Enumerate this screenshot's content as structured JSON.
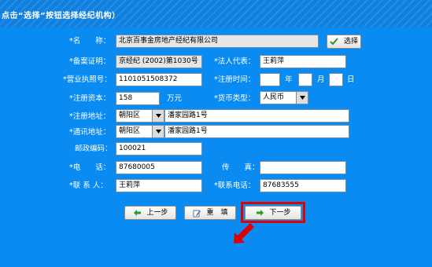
{
  "header": {
    "instruction": "点击“选择”按钮选择经纪机构）"
  },
  "form": {
    "name": {
      "label": "名　　称：",
      "value": "北京百事金房地产经纪有限公司",
      "select_button": "选择"
    },
    "filing_cert": {
      "label": "备案证明：",
      "value": "京经纪 (2002)第1030号"
    },
    "legal_rep": {
      "label": "法人代表：",
      "value": "王莉萍"
    },
    "business_license": {
      "label": "营业执照号：",
      "value": "1101051508372"
    },
    "reg_time": {
      "label": "注册时间：",
      "year_unit": "年",
      "month_unit": "月",
      "day_unit": "日",
      "year": "",
      "month": "",
      "day": ""
    },
    "reg_capital": {
      "label": "注册资本：",
      "value": "158",
      "unit": "万元"
    },
    "currency": {
      "label": "货币类型：",
      "value": "人民币"
    },
    "reg_address": {
      "label": "注册地址：",
      "district": "朝阳区",
      "street": "潘家园路1号"
    },
    "mail_address": {
      "label": "通讯地址：",
      "district": "朝阳区",
      "street": "潘家园路1号"
    },
    "postcode": {
      "label": "邮政编码：",
      "value": "100021"
    },
    "phone": {
      "label": "电　　话：",
      "value": "87680005"
    },
    "fax": {
      "label": "传　　真：",
      "value": ""
    },
    "contact": {
      "label": "联 系 人：",
      "value": "王莉萍"
    },
    "contact_phone": {
      "label": "联系电话：",
      "value": "87683555"
    },
    "required_mark": "*"
  },
  "buttons": {
    "prev": "上一步",
    "reset": "重　填",
    "next": "下一步"
  },
  "colors": {
    "background": "#0a8bf2",
    "highlight": "#e00000"
  },
  "icons": {
    "select": "checkmark-icon",
    "prev": "arrow-left-icon",
    "reset": "pencil-icon",
    "next": "arrow-right-icon",
    "dropdown": "chevron-down-icon",
    "pointer": "red-arrow-pointer"
  }
}
